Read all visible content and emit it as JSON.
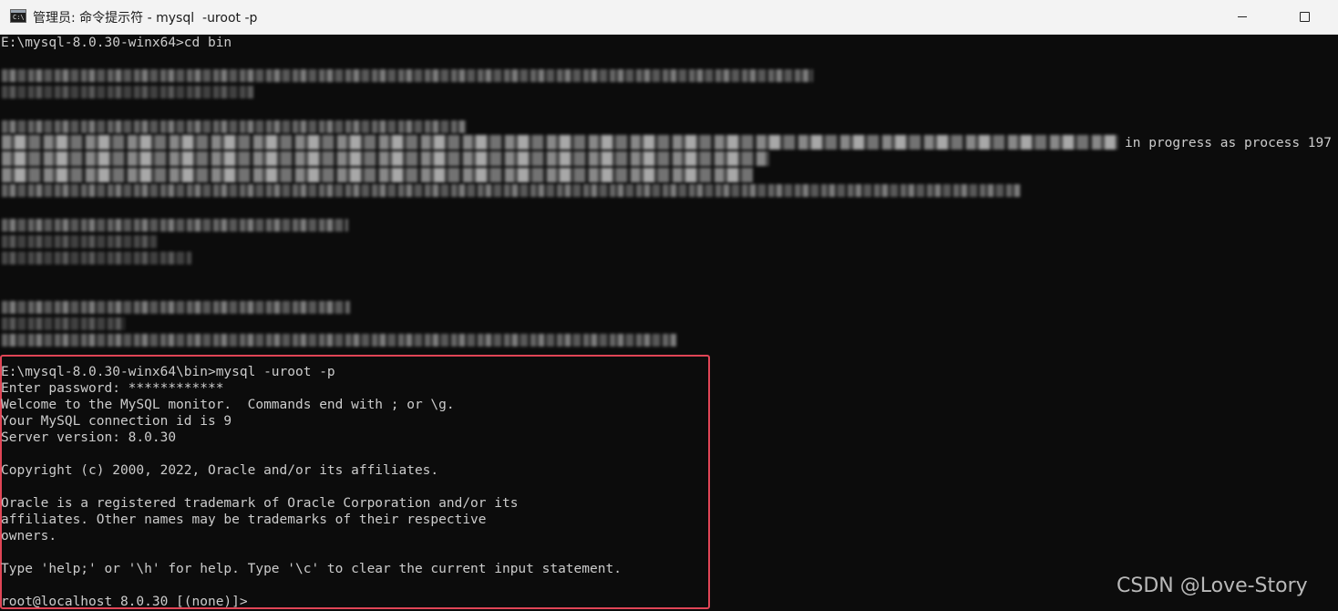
{
  "window": {
    "title": "管理员: 命令提示符 - mysql  -uroot -p",
    "icon_name": "cmd-app-icon",
    "icon_text": "C:\\"
  },
  "console": {
    "first_line": "E:\\mysql-8.0.30-winx64>cd bin",
    "partial_visible_text": "in progress as process 197",
    "session_lines": [
      "E:\\mysql-8.0.30-winx64\\bin>mysql -uroot -p",
      "Enter password: ************",
      "Welcome to the MySQL monitor.  Commands end with ; or \\g.",
      "Your MySQL connection id is 9",
      "Server version: 8.0.30",
      "",
      "Copyright (c) 2000, 2022, Oracle and/or its affiliates.",
      "",
      "Oracle is a registered trademark of Oracle Corporation and/or its",
      "affiliates. Other names may be trademarks of their respective",
      "owners.",
      "",
      "Type 'help;' or '\\h' for help. Type '\\c' to clear the current input statement.",
      "",
      "root@localhost 8.0.30 [(none)]>"
    ]
  },
  "watermark": "CSDN @Love-Story",
  "colors": {
    "console_bg": "#0c0c0c",
    "console_text": "#cccccc",
    "highlight_border": "#e04556",
    "titlebar_bg": "#f3f3f3"
  }
}
